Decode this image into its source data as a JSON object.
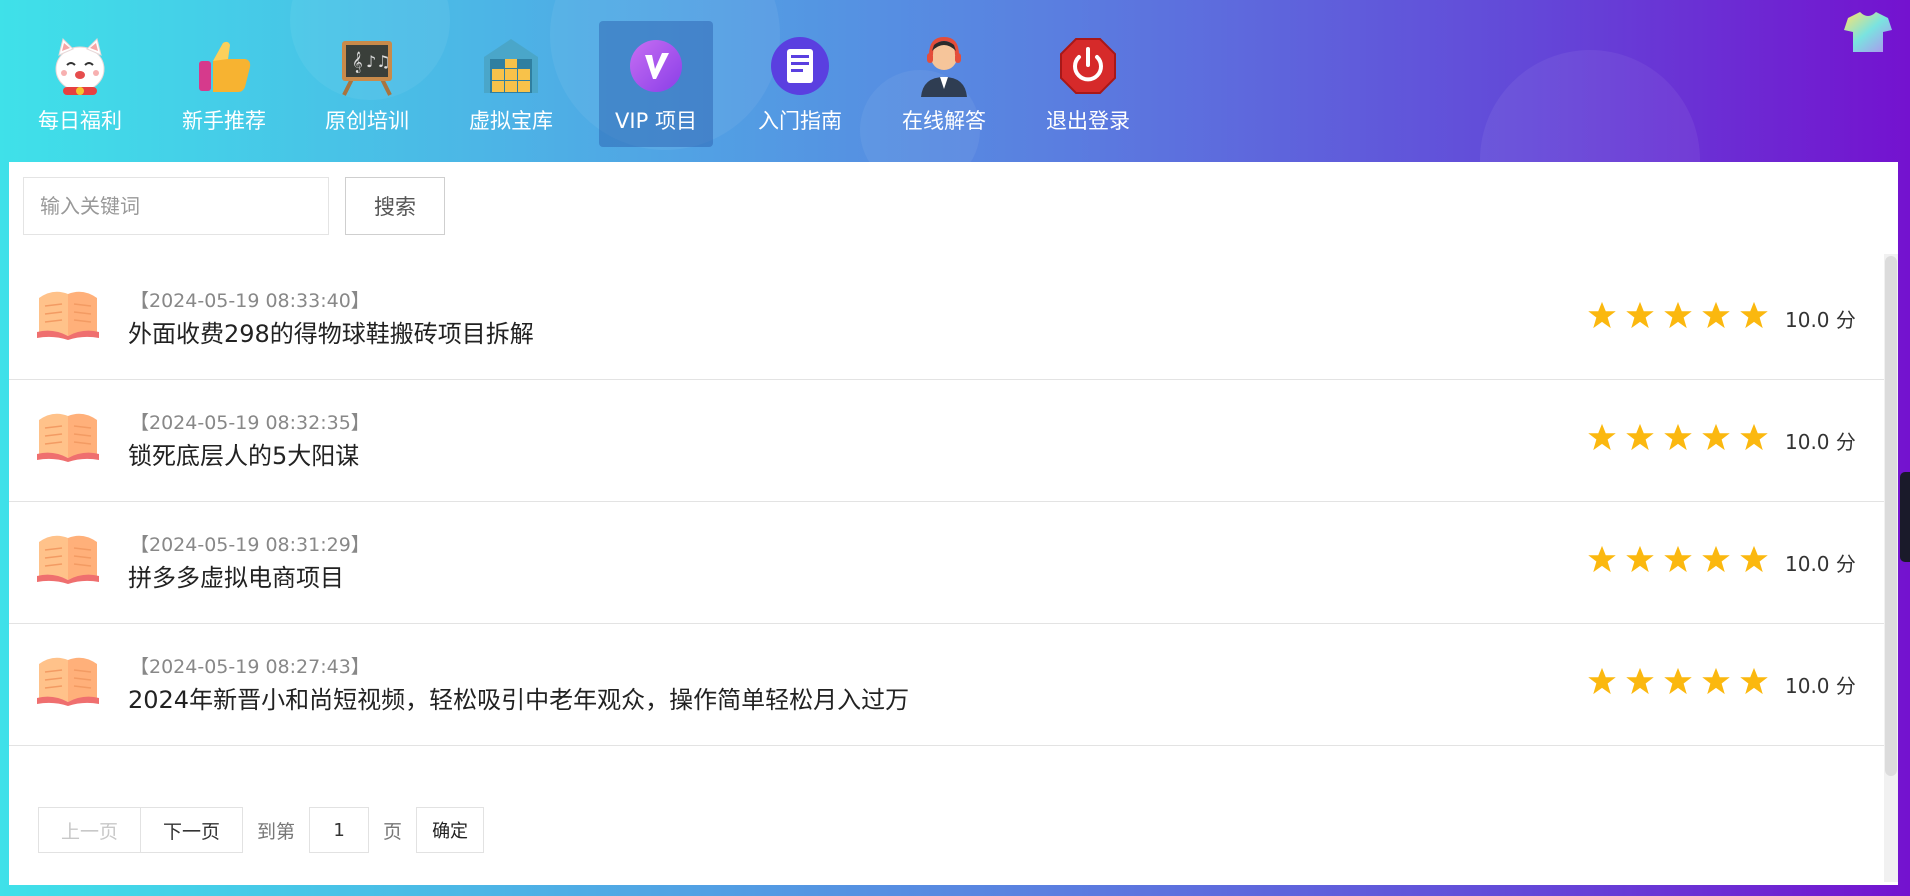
{
  "nav": {
    "items": [
      {
        "label": "每日福利",
        "icon": "lucky-cat-icon",
        "active": false
      },
      {
        "label": "新手推荐",
        "icon": "thumbs-up-icon",
        "active": false
      },
      {
        "label": "原创培训",
        "icon": "blackboard-icon",
        "active": false
      },
      {
        "label": "虚拟宝库",
        "icon": "warehouse-icon",
        "active": false
      },
      {
        "label": "VIP 项目",
        "icon": "vip-badge-icon",
        "active": true
      },
      {
        "label": "入门指南",
        "icon": "document-icon",
        "active": false
      },
      {
        "label": "在线解答",
        "icon": "support-agent-icon",
        "active": false
      },
      {
        "label": "退出登录",
        "icon": "power-icon",
        "active": false
      }
    ]
  },
  "search": {
    "placeholder": "输入关键词",
    "button_label": "搜索"
  },
  "list": {
    "items": [
      {
        "date": "【2024-05-19 08:33:40】",
        "title": "外面收费298的得物球鞋搬砖项目拆解",
        "score": "10.0 分",
        "stars": 5
      },
      {
        "date": "【2024-05-19 08:32:35】",
        "title": "锁死底层人的5大阳谋",
        "score": "10.0 分",
        "stars": 5
      },
      {
        "date": "【2024-05-19 08:31:29】",
        "title": "拼多多虚拟电商项目",
        "score": "10.0 分",
        "stars": 5
      },
      {
        "date": "【2024-05-19 08:27:43】",
        "title": "2024年新晋小和尚短视频，轻松吸引中老年观众，操作简单轻松月入过万",
        "score": "10.0 分",
        "stars": 5
      }
    ]
  },
  "pager": {
    "prev_label": "上一页",
    "next_label": "下一页",
    "goto_prefix": "到第",
    "page_value": "1",
    "goto_suffix": "页",
    "confirm_label": "确定"
  },
  "colors": {
    "star": "#fbb80f",
    "book": "#f5a36a",
    "accent_gradient_start": "#3fe1e9",
    "accent_gradient_end": "#7412cf"
  }
}
